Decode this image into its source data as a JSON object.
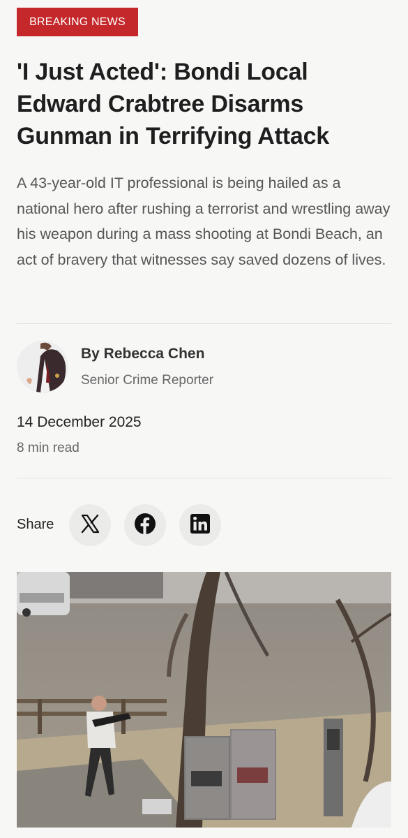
{
  "article": {
    "badge": "BREAKING NEWS",
    "headline": "'I Just Acted': Bondi Local Edward Crabtree Disarms Gunman in Terrifying Attack",
    "summary": "A 43-year-old IT professional is being hailed as a national hero after rushing a terrorist and wrestling away his weapon during a mass shooting at Bondi Beach, an act of bravery that witnesses say saved dozens of lives.",
    "author_name": "By Rebecca Chen",
    "author_role": "Senior Crime Reporter",
    "date": "14 December 2025",
    "read_time": "8 min read"
  },
  "share": {
    "label": "Share",
    "buttons": [
      {
        "network": "x",
        "icon": "x-logo-icon"
      },
      {
        "network": "facebook",
        "icon": "facebook-logo-icon"
      },
      {
        "network": "linkedin",
        "icon": "linkedin-logo-icon",
        "glyph": "in"
      }
    ]
  },
  "colors": {
    "accent_red": "#c5282b",
    "background": "#f7f7f6",
    "share_button_bg": "#ebebea"
  }
}
